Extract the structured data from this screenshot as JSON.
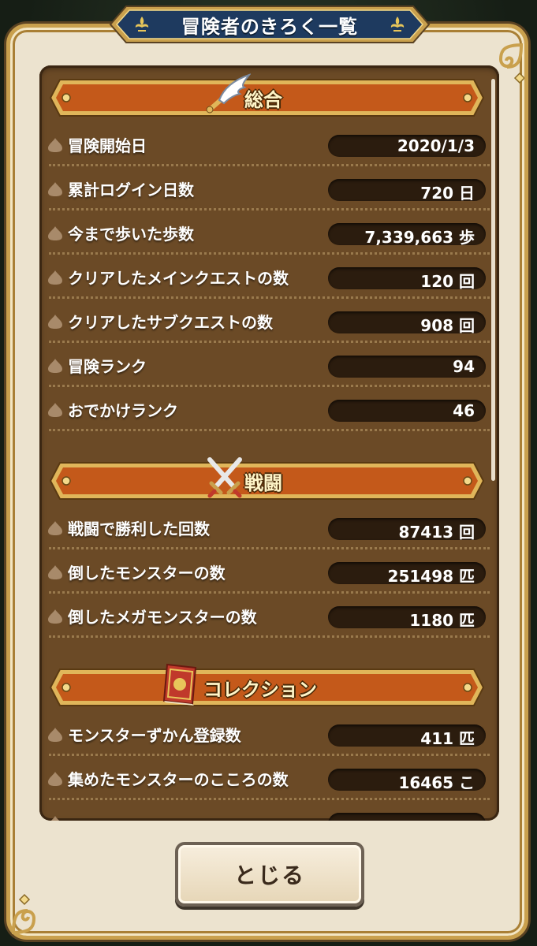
{
  "title": "冒険者のきろく一覧",
  "sections": [
    {
      "label": "総合",
      "icon": "wing-icon",
      "rows": [
        {
          "label": "冒険開始日",
          "value": "2020/1/3"
        },
        {
          "label": "累計ログイン日数",
          "value": "720 日"
        },
        {
          "label": "今まで歩いた歩数",
          "value": "7,339,663 歩"
        },
        {
          "label": "クリアしたメインクエストの数",
          "value": "120 回"
        },
        {
          "label": "クリアしたサブクエストの数",
          "value": "908 回"
        },
        {
          "label": "冒険ランク",
          "value": "94"
        },
        {
          "label": "おでかけランク",
          "value": "46"
        }
      ]
    },
    {
      "label": "戦闘",
      "icon": "crossed-swords-icon",
      "rows": [
        {
          "label": "戦闘で勝利した回数",
          "value": "87413 回"
        },
        {
          "label": "倒したモンスターの数",
          "value": "251498 匹"
        },
        {
          "label": "倒したメガモンスターの数",
          "value": "1180 匹"
        }
      ]
    },
    {
      "label": "コレクション",
      "icon": "book-icon",
      "rows": [
        {
          "label": "モンスターずかん登録数",
          "value": "411 匹"
        },
        {
          "label": "集めたモンスターのこころの数",
          "value": "16465 こ"
        }
      ]
    }
  ],
  "close_button": "とじる",
  "colors": {
    "parchment": "#ece3cf",
    "panel": "#6b4a26",
    "banner": "#c4591a",
    "title_plate": "#1e3a5f",
    "gold": "#c9a04d"
  }
}
